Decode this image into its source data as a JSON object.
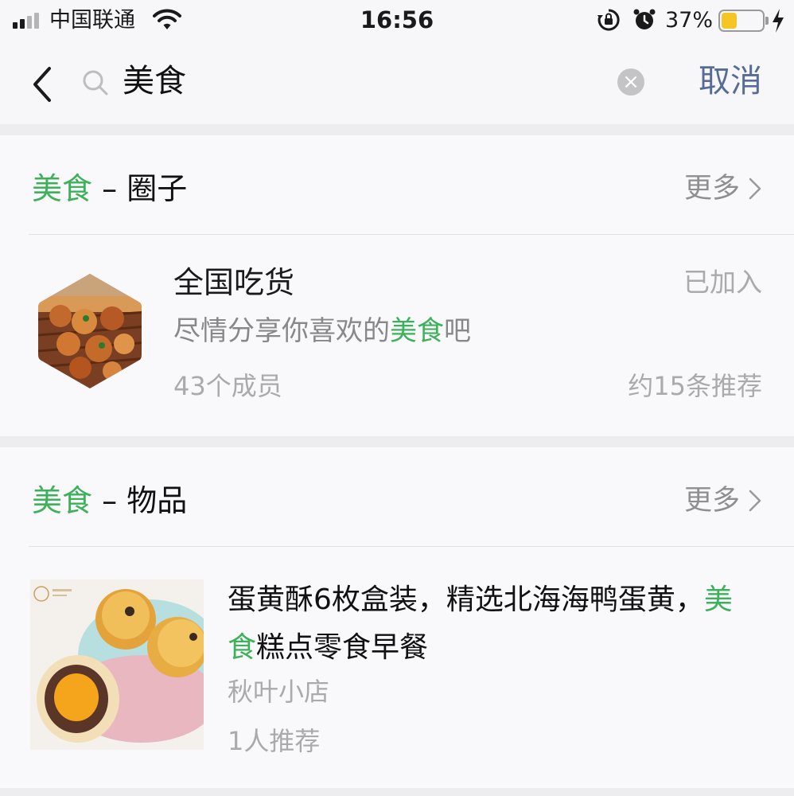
{
  "status_bar": {
    "carrier": "中国联通",
    "time": "16:56",
    "battery_percent": "37%",
    "battery_level": 0.37,
    "battery_color": "#f5c523"
  },
  "search": {
    "query": "美食",
    "cancel_label": "取消",
    "clear_icon": "×"
  },
  "colors": {
    "highlight": "#3db05a",
    "link": "#576b95"
  },
  "sections": {
    "circles": {
      "keyword": "美食",
      "separator": " – ",
      "title": "圈子",
      "more_label": "更多",
      "item": {
        "name": "全国吃货",
        "status": "已加入",
        "desc_before": "尽情分享你喜欢的",
        "desc_highlight": "美食",
        "desc_after": "吧",
        "members": "43个成员",
        "recommendations": "约15条推荐"
      }
    },
    "goods": {
      "keyword": "美食",
      "separator": " – ",
      "title": "物品",
      "more_label": "更多",
      "item": {
        "title_before": "蛋黄酥6枚盒装，精选北海海鸭蛋黄，",
        "title_highlight": "美食",
        "title_after": "糕点零食早餐",
        "shop": "秋叶小店",
        "recommend_count": "1人推荐"
      }
    }
  }
}
